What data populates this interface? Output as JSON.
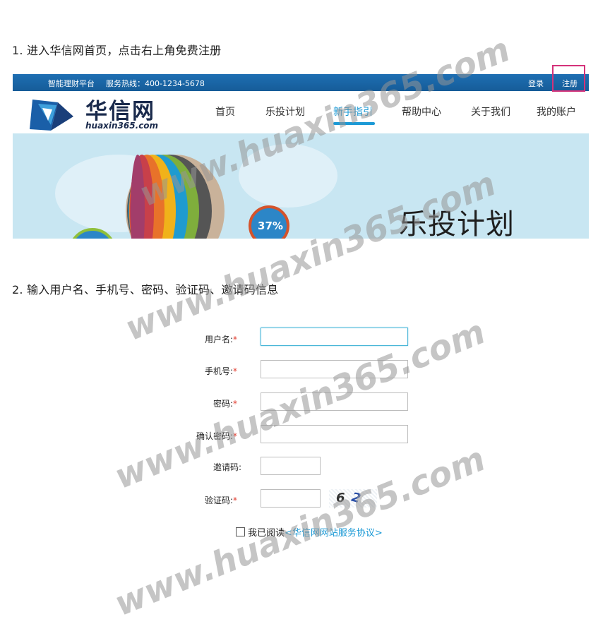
{
  "steps": {
    "step1": "1. 进入华信网首页，点击右上角免费注册",
    "step2": "2. 输入用户名、手机号、密码、验证码、邀请码信息"
  },
  "topbar": {
    "slogan": "智能理财平台",
    "hotline": "服务热线：400-1234-5678",
    "login": "登录",
    "register": "注册"
  },
  "logo": {
    "text": "华信网",
    "domain": "huaxin365.com"
  },
  "nav": {
    "items": [
      "首页",
      "乐投计划",
      "新手指引",
      "帮助中心",
      "关于我们",
      "我的账户"
    ],
    "active_index": 2
  },
  "banner": {
    "title": "乐投计划",
    "percent": "37%"
  },
  "form": {
    "username_label": "用户名:",
    "phone_label": "手机号:",
    "password_label": "密码:",
    "confirm_label": "确认密码:",
    "invite_label": "邀请码:",
    "captcha_label": "验证码:",
    "required_mark": "*",
    "captcha_text": [
      "6",
      "2"
    ],
    "agree_text": "我已阅读",
    "agree_link": "<华信网网站服务协议>"
  },
  "watermark": "www.huaxin365.com",
  "colors": {
    "accent": "#1c9ad6",
    "topbar": "#1e6fb3",
    "highlight": "#d4327a",
    "required": "#e23b2e"
  }
}
